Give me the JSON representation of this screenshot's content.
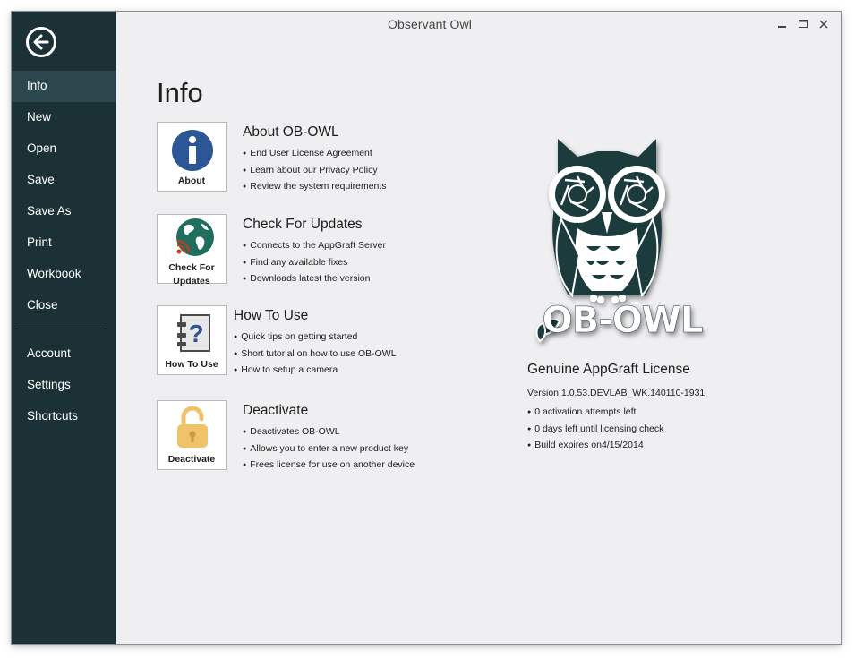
{
  "window": {
    "title": "Observant Owl"
  },
  "sidebar": {
    "items": [
      "Info",
      "New",
      "Open",
      "Save",
      "Save As",
      "Print",
      "Workbook",
      "Close"
    ],
    "items2": [
      "Account",
      "Settings",
      "Shortcuts"
    ],
    "active": "Info"
  },
  "main": {
    "title": "Info",
    "sections": [
      {
        "tile_label": "About",
        "title": "About OB-OWL",
        "bullets": [
          "End User License Agreement",
          "Learn about our Privacy Policy",
          "Review the system requirements"
        ]
      },
      {
        "tile_label_1": "Check For",
        "tile_label_2": "Updates",
        "title": "Check For Updates",
        "bullets": [
          "Connects to the AppGraft Server",
          "Find any available fixes",
          "Downloads latest the version"
        ]
      },
      {
        "tile_label": "How To Use",
        "title": "How To Use",
        "bullets": [
          "Quick tips on getting started",
          "Short tutorial on how to use OB-OWL",
          "How to setup a camera"
        ]
      },
      {
        "tile_label": "Deactivate",
        "title": "Deactivate",
        "bullets": [
          "Deactivates OB-OWL",
          "Allows you to enter a new product key",
          "Frees license for use on another device"
        ]
      }
    ]
  },
  "license": {
    "logo_text": "OB-OWL",
    "title": "Genuine AppGraft License",
    "version": "Version 1.0.53.DEVLAB_WK.140110-1931",
    "bullets": [
      "0 activation attempts left",
      "0 days left until licensing check",
      "Build expires on4/15/2014"
    ]
  },
  "icons": {
    "back": "back-arrow-icon",
    "about": "info-icon",
    "updates": "globe-rss-icon",
    "howto": "help-book-icon",
    "deactivate": "padlock-icon",
    "logo": "owl-logo-icon"
  },
  "colors": {
    "sidebar": "#1c3136",
    "sidebar_active": "#2b464c",
    "info_blue": "#2b5797",
    "globe": "#1f6e5e",
    "rss": "#c63c1c",
    "lock": "#f0c26a",
    "owl": "#1d3a3e"
  }
}
